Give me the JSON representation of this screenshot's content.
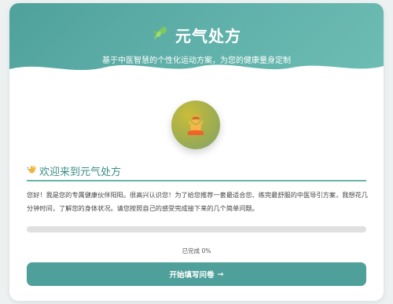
{
  "header": {
    "title": "元气处方",
    "subtitle": "基于中医智慧的个性化运动方案，为您的健康量身定制",
    "title_icon": "leaf-icon"
  },
  "avatar": {
    "icon": "meditating-person-icon"
  },
  "welcome": {
    "icon": "waving-hand-icon",
    "title": "欢迎来到元气处方",
    "text": "您好！我是您的专属健康伙伴阳阳。很高兴认识您！为了给您推荐一套最适合您、练完最舒服的中医导引方案，我想花几分钟时间，了解您的身体状况。请您按照自己的感受完成接下来的几个简单问题。"
  },
  "progress": {
    "value": 0,
    "label": "已完成 0%"
  },
  "start_button": {
    "label": "开始填写问卷",
    "arrow": "→"
  },
  "colors": {
    "accent": "#4f9f9a",
    "header_gradient_start": "#4fa19c",
    "header_gradient_end": "#6dbdb4",
    "track": "#e0e0e0"
  }
}
